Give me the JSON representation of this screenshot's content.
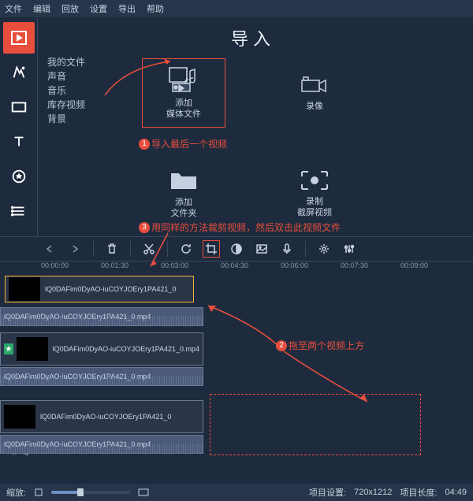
{
  "menu": {
    "items": [
      "文件",
      "编辑",
      "回放",
      "设置",
      "导出",
      "帮助"
    ]
  },
  "leftTools": [
    {
      "name": "import-tab",
      "active": true
    },
    {
      "name": "filters-tab",
      "active": false
    },
    {
      "name": "video-tab",
      "active": false
    },
    {
      "name": "titles-tab",
      "active": false
    },
    {
      "name": "stickers-tab",
      "active": false
    },
    {
      "name": "more-tab",
      "active": false
    }
  ],
  "panel": {
    "title": "导入",
    "categories": [
      "我的文件",
      "声音",
      "音乐",
      "库存视频",
      "背景"
    ],
    "tiles": [
      {
        "name": "add-media-tile",
        "line1": "添加",
        "line2": "媒体文件",
        "hl": true
      },
      {
        "name": "record-camera-tile",
        "line1": "录像",
        "line2": ""
      },
      {
        "name": "add-folder-tile",
        "line1": "添加",
        "line2": "文件夹"
      },
      {
        "name": "screen-record-tile",
        "line1": "录制",
        "line2": "截屏视频"
      }
    ]
  },
  "ann": {
    "a1": "导入最后一个视频",
    "a2": "拖至两个视频上方",
    "a3": "用同样的方法裁剪视频，然后双击此视频文件"
  },
  "ruler": [
    "00:00:00",
    "00:01:30",
    "00:03:00",
    "00:04:30",
    "00:06:00",
    "00:07:30",
    "00:09:00"
  ],
  "clips": {
    "c1": "lQ0DAFim0DyAO-iuCOYJOEry1PA421_0",
    "c2": "lQ0DAFim0DyAO-iuCOYJOEry1PA421_0.mp4",
    "c3": "lQ0DAFim0DyAO-iuCOYJOEry1PA421_0.mp4",
    "c4": "lQ0DAFim0DyAO-iuCOYJOEry1PA421_0",
    "c5": "lQ0DAFim0DyAO-iuCOYJOEry1PA421_0.mp4"
  },
  "status": {
    "zoomLabel": "缩放:",
    "projLabel": "项目设置:",
    "projVal": "720x1212",
    "durLabel": "项目长度:",
    "durVal": "04:49"
  }
}
